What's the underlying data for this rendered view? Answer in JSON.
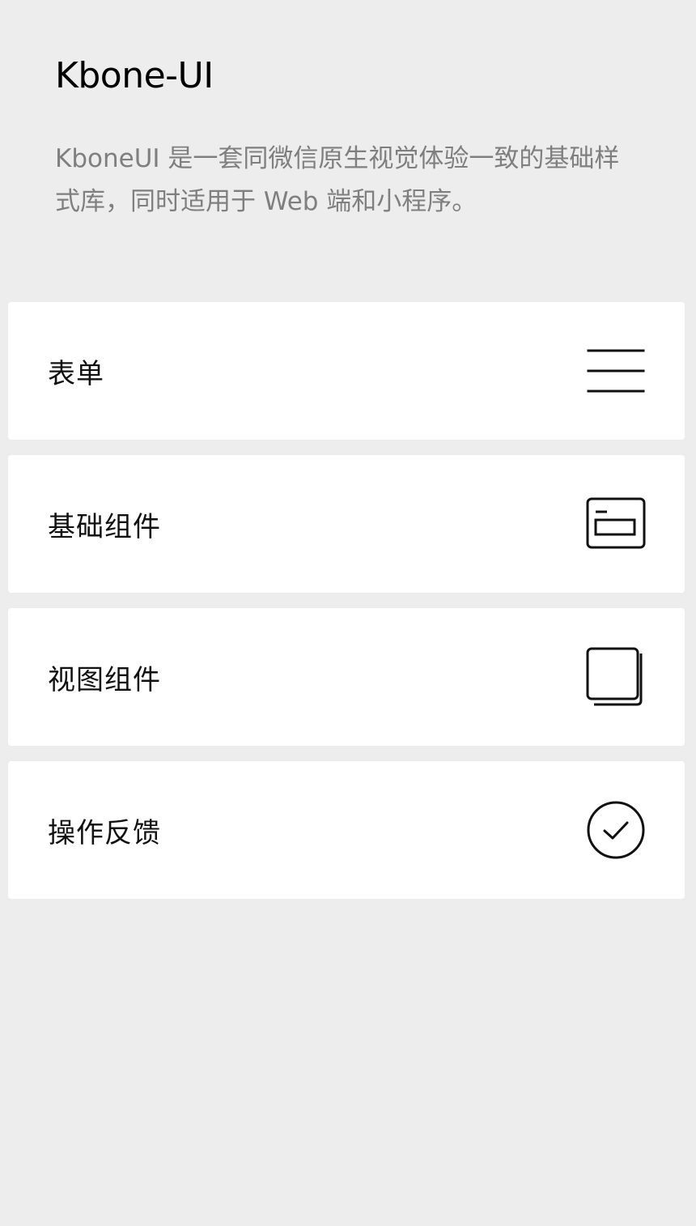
{
  "header": {
    "title": "Kbone-UI",
    "description": "KboneUI 是一套同微信原生视觉体验一致的基础样式库，同时适用于 Web 端和小程序。"
  },
  "menu": {
    "items": [
      {
        "label": "表单",
        "icon": "form-lines-icon"
      },
      {
        "label": "基础组件",
        "icon": "base-component-icon"
      },
      {
        "label": "视图组件",
        "icon": "view-stack-icon"
      },
      {
        "label": "操作反馈",
        "icon": "check-circle-icon"
      }
    ]
  },
  "colors": {
    "page_background": "#ededed",
    "card_background": "#ffffff",
    "title": "#000000",
    "description": "#7f7f7f",
    "item_label": "#111111",
    "icon_stroke": "#111111"
  }
}
